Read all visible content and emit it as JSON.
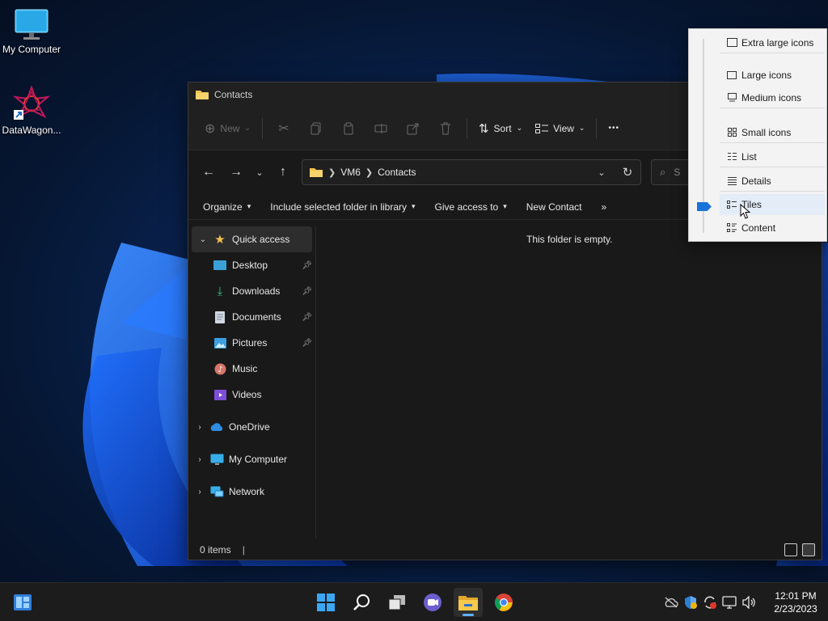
{
  "desktop": {
    "icons": [
      {
        "label": "My Computer",
        "icon": "monitor-icon"
      },
      {
        "label": "DataWagon...",
        "icon": "datawagon-shortcut-icon"
      }
    ]
  },
  "explorer": {
    "title": "Contacts",
    "toolbar": {
      "new_label": "New",
      "sort_label": "Sort",
      "view_label": "View",
      "more_label": "•••",
      "icons": [
        "cut-icon",
        "copy-icon",
        "paste-icon",
        "rename-icon",
        "share-icon",
        "delete-icon"
      ]
    },
    "address": {
      "crumbs": [
        "VM6",
        "Contacts"
      ],
      "search_placeholder": "S"
    },
    "commands": [
      "Organize",
      "Include selected folder in library",
      "Give access to",
      "New Contact",
      "»"
    ],
    "nav": {
      "quick_access": "Quick access",
      "pinned": [
        "Desktop",
        "Downloads",
        "Documents",
        "Pictures"
      ],
      "unpinned": [
        "Music",
        "Videos"
      ],
      "onedrive": "OneDrive",
      "mycomputer": "My Computer",
      "network": "Network"
    },
    "empty_message": "This folder is empty.",
    "status": {
      "items": "0 items"
    }
  },
  "view_menu": {
    "selected": "Tiles",
    "items": [
      "Extra large icons",
      "Large icons",
      "Medium icons",
      "Small icons",
      "List",
      "Details",
      "Tiles",
      "Content"
    ]
  },
  "taskbar": {
    "apps": [
      "widgets-icon",
      "start-icon",
      "search-icon",
      "task-view-icon",
      "teams-chat-icon",
      "file-explorer-icon",
      "chrome-icon"
    ],
    "tray": [
      "network-offline-icon",
      "security-icon",
      "sync-icon",
      "display-icon",
      "volume-icon"
    ],
    "time": "12:01 PM",
    "date": "2/23/2023"
  },
  "colors": {
    "accent": "#1a73d9",
    "folder_yellow": "#f2c14e",
    "window_bg": "#191919",
    "menu_bg": "#f3f3f3"
  }
}
